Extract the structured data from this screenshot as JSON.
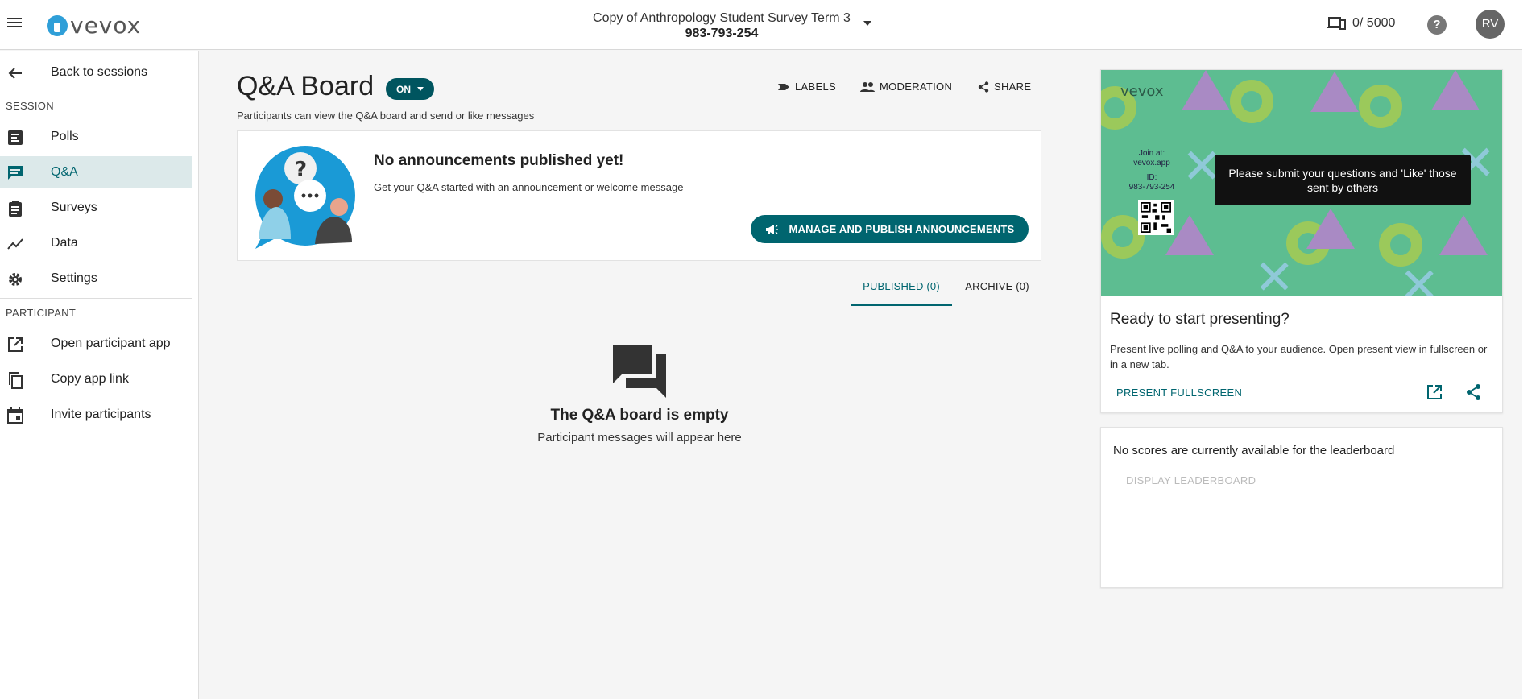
{
  "topbar": {
    "brand": "vevox",
    "session_name": "Copy of Anthropology Student Survey Term 3",
    "session_code": "983-793-254",
    "participants": "0/ 5000",
    "help": "?",
    "avatar_initials": "RV"
  },
  "sidebar": {
    "back": "Back to sessions",
    "session_heading": "SESSION",
    "session_items": [
      {
        "label": "Polls",
        "icon": "polls-icon"
      },
      {
        "label": "Q&A",
        "icon": "qa-icon"
      },
      {
        "label": "Surveys",
        "icon": "surveys-icon"
      },
      {
        "label": "Data",
        "icon": "data-icon"
      },
      {
        "label": "Settings",
        "icon": "gear-icon"
      }
    ],
    "participant_heading": "PARTICIPANT",
    "participant_items": [
      {
        "label": "Open participant app",
        "icon": "open-external-icon"
      },
      {
        "label": "Copy app link",
        "icon": "copy-icon"
      },
      {
        "label": "Invite participants",
        "icon": "calendar-icon"
      }
    ],
    "active_item": "Q&A"
  },
  "main": {
    "title": "Q&A Board",
    "toggle": "ON",
    "subtitle": "Participants can view the Q&A board and send or like messages",
    "actions": {
      "labels": "LABELS",
      "moderation": "MODERATION",
      "share": "SHARE"
    },
    "announcement": {
      "heading": "No announcements published yet!",
      "description": "Get your Q&A started with an announcement or welcome message",
      "button": "MANAGE AND PUBLISH ANNOUNCEMENTS"
    },
    "tabs": {
      "published": "PUBLISHED (0)",
      "archive": "ARCHIVE (0)"
    },
    "empty": {
      "title": "The Q&A board is empty",
      "subtitle": "Participant messages will appear here"
    }
  },
  "present": {
    "preview": {
      "brand": "vevox",
      "join_label": "Join at:",
      "join_url": "vevox.app",
      "id_label": "ID:",
      "id_value": "983-793-254",
      "message": "Please submit your questions and 'Like' those sent by others"
    },
    "title": "Ready to start presenting?",
    "description": "Present live polling and Q&A to your audience. Open present view in fullscreen or in a new tab.",
    "button": "PRESENT FULLSCREEN"
  },
  "leaderboard": {
    "message": "No scores are currently available for the leaderboard",
    "button": "DISPLAY LEADERBOARD"
  },
  "colors": {
    "accent": "#00656f",
    "toggle": "#00555f",
    "active_bg": "#dce9ea",
    "brand_blue": "#2f9fd8"
  }
}
